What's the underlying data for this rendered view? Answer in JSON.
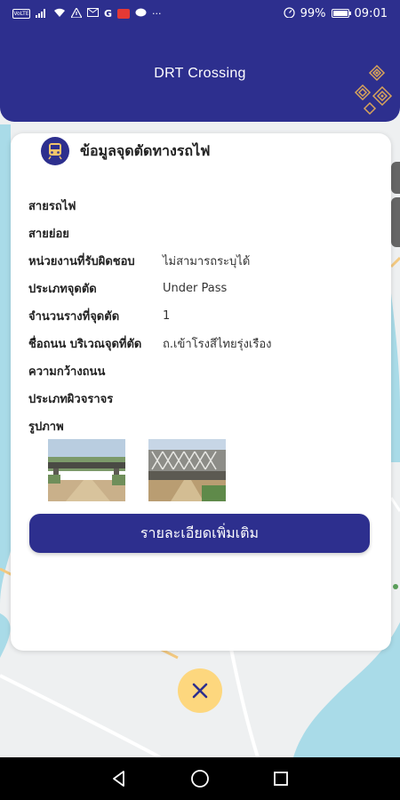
{
  "status_bar": {
    "carrier_badge": "VoLTE",
    "network": "G",
    "battery": "99%",
    "time": "09:01",
    "more": "···"
  },
  "header": {
    "title": "DRT Crossing"
  },
  "card": {
    "title": "ข้อมูลจุดตัดทางรถไฟ",
    "rows": [
      {
        "label": "สายรถไฟ",
        "value": ""
      },
      {
        "label": "สายย่อย",
        "value": ""
      },
      {
        "label": "หน่วยงานที่รับผิดชอบ",
        "value": "ไม่สามารถระบุได้"
      },
      {
        "label": "ประเภทจุดตัด",
        "value": "Under Pass"
      },
      {
        "label": "จำนวนรางที่จุดตัด",
        "value": "1"
      },
      {
        "label": "ชื่อถนน บริเวณจุดที่ตัด",
        "value": "ถ.เข้าโรงสีไทยรุ่งเรือง"
      },
      {
        "label": "ความกว้างถนน",
        "value": ""
      },
      {
        "label": "ประเภทผิวจราจร",
        "value": ""
      },
      {
        "label": "รูปภาพ",
        "value": ""
      }
    ],
    "more_button": "รายละเอียดเพิ่มเติม"
  },
  "colors": {
    "primary": "#2d2f8e",
    "fab": "#fdd77e",
    "river": "#a9dbe8"
  },
  "icons": {
    "train": "train-icon",
    "close": "close-icon",
    "back": "nav-back-icon",
    "home": "nav-home-icon",
    "recents": "nav-recents-icon"
  }
}
